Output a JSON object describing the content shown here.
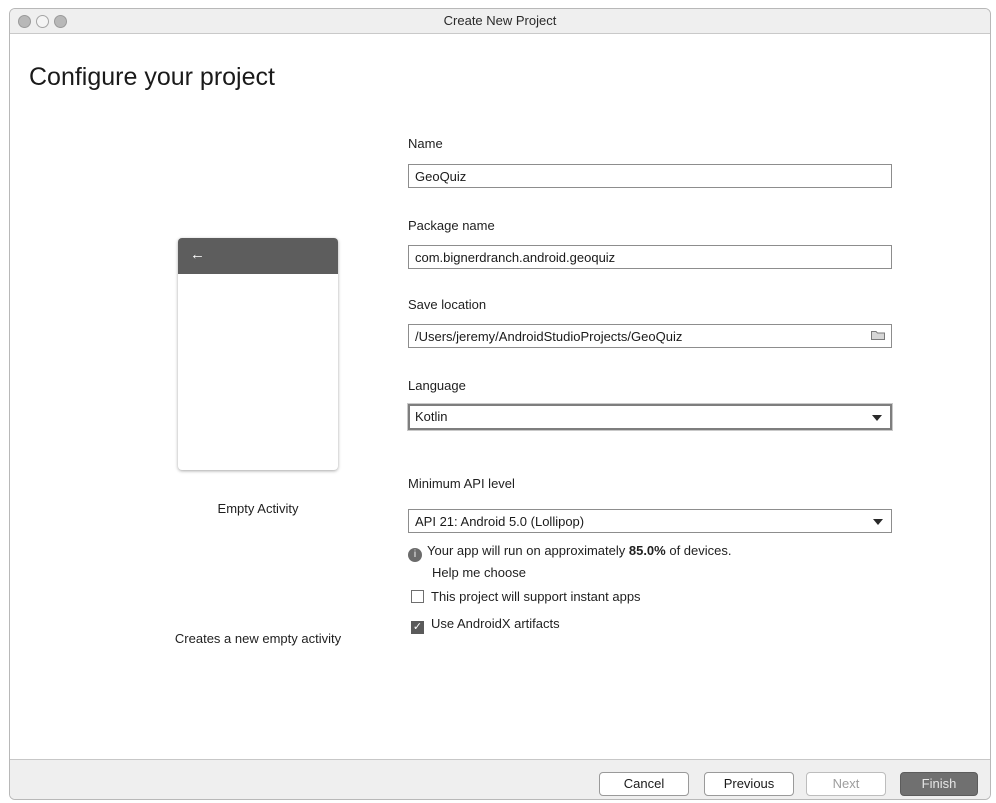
{
  "window": {
    "title": "Create New Project"
  },
  "page": {
    "heading": "Configure your project"
  },
  "template": {
    "name": "Empty Activity",
    "description": "Creates a new empty activity",
    "back_glyph": "←"
  },
  "form": {
    "name": {
      "label": "Name",
      "value": "GeoQuiz"
    },
    "package": {
      "label": "Package name",
      "value": "com.bignerdranch.android.geoquiz"
    },
    "save_location": {
      "label": "Save location",
      "value": "/Users/jeremy/AndroidStudioProjects/GeoQuiz"
    },
    "language": {
      "label": "Language",
      "value": "Kotlin"
    },
    "min_api": {
      "label": "Minimum API level",
      "value": "API 21: Android 5.0 (Lollipop)"
    },
    "info": {
      "prefix": "Your app will run on approximately ",
      "percent": "85.0%",
      "suffix": " of devices."
    },
    "help_link": "Help me choose",
    "instant_apps": {
      "label": "This project will support instant apps",
      "checked": false
    },
    "androidx": {
      "label": "Use AndroidX artifacts",
      "checked": true
    }
  },
  "buttons": {
    "cancel": "Cancel",
    "previous": "Previous",
    "next": "Next",
    "finish": "Finish"
  },
  "icons": {
    "info": "info-icon",
    "folder": "folder-icon",
    "dropdown": "chevron-down-icon",
    "check": "check-icon",
    "back": "back-arrow-icon"
  }
}
